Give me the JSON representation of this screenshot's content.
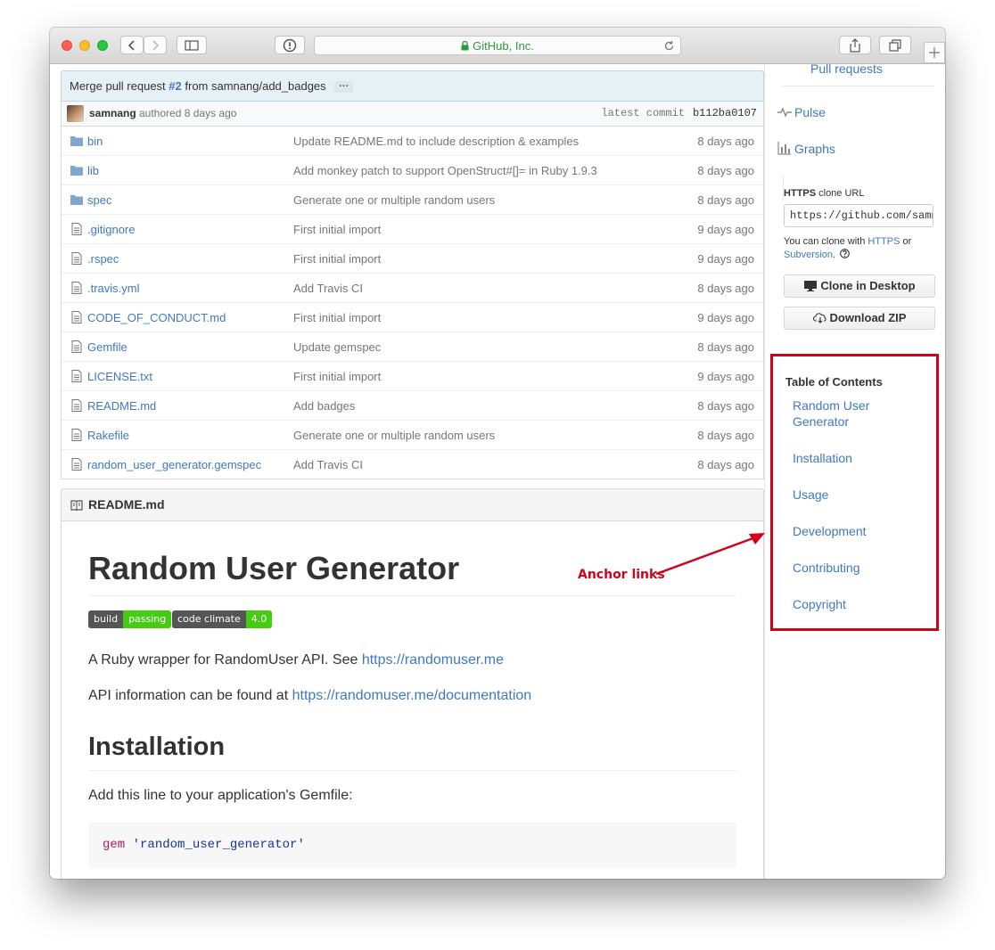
{
  "browser": {
    "address_text": "GitHub, Inc."
  },
  "commit": {
    "message_prefix": "Merge pull request",
    "pr_link": "#2",
    "message_suffix": "from samnang/add_badges",
    "ellipsis": "···",
    "author": "samnang",
    "authored_text": "authored 8 days ago",
    "latest_label": "latest commit",
    "sha": "b112ba0107"
  },
  "files": [
    {
      "name": "bin",
      "type": "folder",
      "message": "Update README.md to include description & examples",
      "age": "8 days ago"
    },
    {
      "name": "lib",
      "type": "folder",
      "message": "Add monkey patch to support OpenStruct#[]= in Ruby 1.9.3",
      "age": "8 days ago"
    },
    {
      "name": "spec",
      "type": "folder",
      "message": "Generate one or multiple random users",
      "age": "8 days ago"
    },
    {
      "name": ".gitignore",
      "type": "file",
      "message": "First initial import",
      "age": "9 days ago"
    },
    {
      "name": ".rspec",
      "type": "file",
      "message": "First initial import",
      "age": "9 days ago"
    },
    {
      "name": ".travis.yml",
      "type": "file",
      "message": "Add Travis CI",
      "age": "8 days ago"
    },
    {
      "name": "CODE_OF_CONDUCT.md",
      "type": "file",
      "message": "First initial import",
      "age": "9 days ago"
    },
    {
      "name": "Gemfile",
      "type": "file",
      "message": "Update gemspec",
      "age": "8 days ago"
    },
    {
      "name": "LICENSE.txt",
      "type": "file",
      "message": "First initial import",
      "age": "9 days ago"
    },
    {
      "name": "README.md",
      "type": "file",
      "message": "Add badges",
      "age": "8 days ago"
    },
    {
      "name": "Rakefile",
      "type": "file",
      "message": "Generate one or multiple random users",
      "age": "8 days ago"
    },
    {
      "name": "random_user_generator.gemspec",
      "type": "file",
      "message": "Add Travis CI",
      "age": "8 days ago"
    }
  ],
  "readme": {
    "header": "README.md",
    "title": "Random User Generator",
    "badges": [
      {
        "left": "build",
        "right": "passing",
        "color": "#4c1"
      },
      {
        "left": "code climate",
        "right": "4.0",
        "color": "#4c1"
      }
    ],
    "p1_text": "A Ruby wrapper for RandomUser API. See ",
    "p1_link": "https://randomuser.me",
    "p2_text": "API information can be found at ",
    "p2_link": "https://randomuser.me/documentation",
    "h2_installation": "Installation",
    "p3_text": "Add this line to your application's Gemfile:",
    "code_keyword": "gem",
    "code_string": "'random_user_generator'"
  },
  "sidebar": {
    "pull_requests": "Pull requests",
    "pulse": "Pulse",
    "graphs": "Graphs",
    "clone_label_bold": "HTTPS",
    "clone_label_rest": "clone URL",
    "clone_url": "https://github.com/samnang/random_user_generator.git",
    "clone_help_prefix": "You can clone with",
    "clone_help_https": "HTTPS",
    "clone_help_or": "or",
    "clone_help_svn": "Subversion",
    "clone_help_end": ".",
    "clone_desktop": "Clone in Desktop",
    "download_zip": "Download ZIP"
  },
  "toc": {
    "title": "Table of Contents",
    "items": [
      "Random User Generator",
      "Installation",
      "Usage",
      "Development",
      "Contributing",
      "Copyright"
    ]
  },
  "annotation": {
    "label": "Anchor links",
    "color": "#d0021b"
  },
  "colors": {
    "link": "#4078c0",
    "annotation_red": "#d0021b",
    "badge_green": "#4c1",
    "badge_gray": "#555"
  }
}
